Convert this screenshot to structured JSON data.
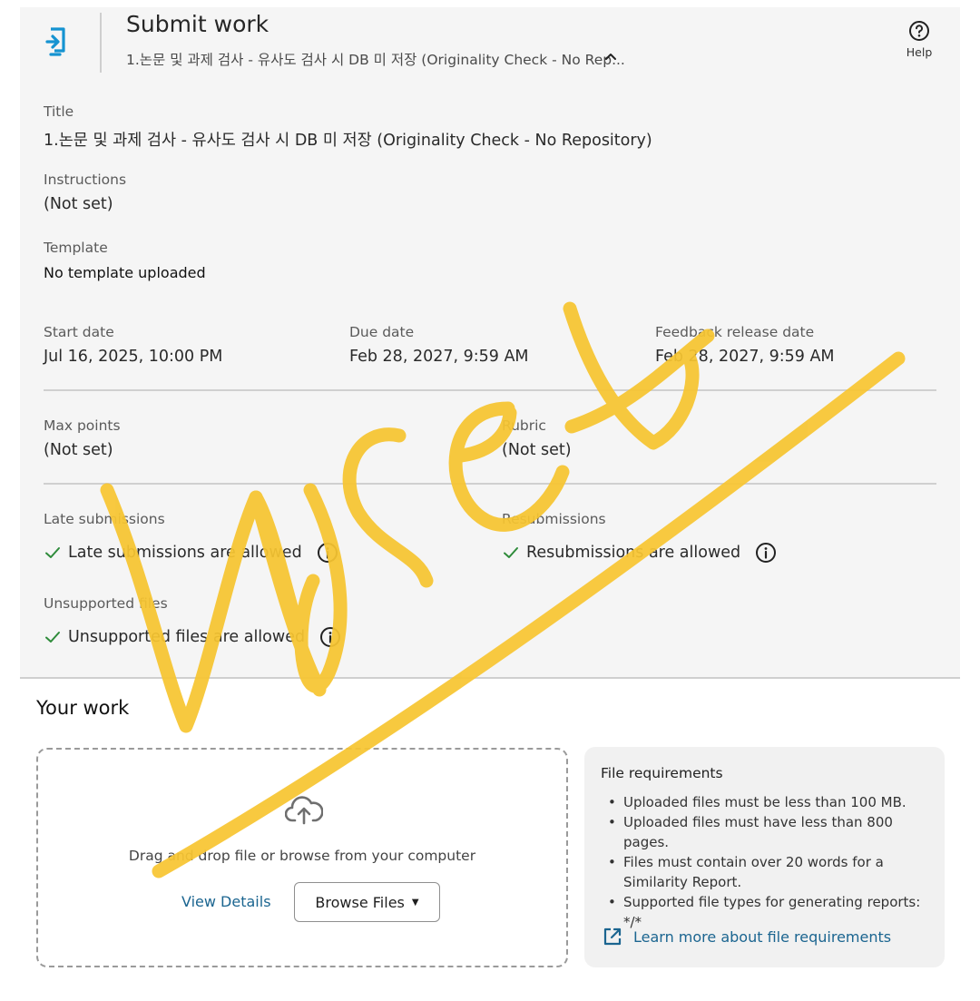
{
  "header": {
    "title": "Submit work",
    "assignment_crumb": "1.논문 및 과제 검사 - 유사도 검사 시 DB 미 저장 (Originality Check - No Rep...",
    "help_label": "Help",
    "logo_icon": "submit-file-icon",
    "accent_color": "#1593d1"
  },
  "details": {
    "title_label": "Title",
    "title_value": "1.논문 및 과제 검사 - 유사도 검사 시 DB 미 저장 (Originality Check - No Repository)",
    "instructions_label": "Instructions",
    "instructions_value": "(Not set)",
    "template_label": "Template",
    "template_value": "No template uploaded",
    "start_label": "Start date",
    "start_value": "Jul 16, 2025, 10:00 PM",
    "due_label": "Due date",
    "due_value": "Feb 28, 2027, 9:59 AM",
    "feedback_label": "Feedback release date",
    "feedback_value": "Feb 28, 2027, 9:59 AM",
    "max_points_label": "Max points",
    "max_points_value": "(Not set)",
    "rubric_label": "Rubric",
    "rubric_value": "(Not set)",
    "late_label": "Late submissions",
    "late_value": "Late submissions are allowed",
    "resub_label": "Resubmissions",
    "resub_value": "Resubmissions are allowed",
    "unsupported_label": "Unsupported files",
    "unsupported_value": "Unsupported files are allowed",
    "check_color": "#2e8b3a"
  },
  "your_work": {
    "heading": "Your work",
    "drop_text": "Drag and drop file or browse from your computer",
    "view_details": "View Details",
    "browse_files": "Browse Files",
    "upload_icon": "cloud-upload-icon"
  },
  "requirements": {
    "title": "File requirements",
    "items": [
      "Uploaded files must be less than 100 MB.",
      "Uploaded files must have less than 800 pages.",
      "Files must contain over 20 words for a Similarity Report.",
      "Supported file types for generating reports: */*"
    ],
    "link_text": "Learn more about file requirements",
    "link_color": "#1b6590"
  },
  "overlay": {
    "scribble_color": "#f7c531"
  }
}
